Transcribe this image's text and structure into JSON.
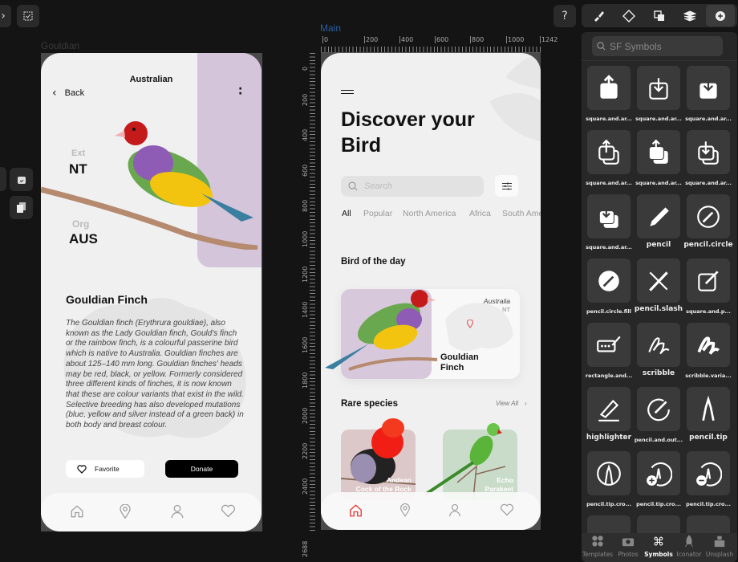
{
  "toolbar_left": {
    "expand_icon": "chevron-right-icon",
    "select_icon": "checkbox-icon"
  },
  "help_label": "?",
  "left_artboard": {
    "name": "Gouldian",
    "header_title": "Australian",
    "back_label": "Back",
    "stats": [
      {
        "label": "Ext",
        "value": "NT"
      },
      {
        "label": "Org",
        "value": "AUS"
      }
    ],
    "title": "Gouldian Finch",
    "description": "The Gouldian finch (Erythrura gouldiae), also known as the Lady Gouldian finch, Gould's finch or the rainbow finch, is a colourful passerine bird which is native to Australia. Gouldian finches are about 125–140 mm long. Gouldian finches' heads may be red, black, or yellow. Formerly considered three different kinds of finches, it is now known that these are colour variants that exist in the wild. Selective breeding has also developed mutations (blue, yellow and silver instead of a green back) in both body and breast colour.",
    "favorite_label": "Favorite",
    "donate_label": "Donate",
    "accent": "#d4c5da"
  },
  "main_artboard": {
    "name": "Main",
    "ruler_top": [
      "0",
      "200",
      "400",
      "600",
      "800",
      "1000",
      "1242"
    ],
    "ruler_left": [
      "0",
      "200",
      "400",
      "600",
      "800",
      "1000",
      "1200",
      "1400",
      "1600",
      "1800",
      "2000",
      "2200",
      "2400",
      "2688"
    ],
    "title_line1": "Discover your",
    "title_line2": "Bird",
    "search_placeholder": "Search",
    "tabs": [
      "All",
      "Popular",
      "North America",
      "Africa",
      "South Ame"
    ],
    "bird_of_day_heading": "Bird of the day",
    "bird_of_day": {
      "country": "Australia",
      "region": "NT",
      "name_line1": "Gouldian",
      "name_line2": "Finch"
    },
    "rare_heading": "Rare species",
    "view_all": "View All",
    "rare": [
      {
        "line1": "Andean",
        "line2": "Cock of the Rock",
        "bg": "#dcc8c8"
      },
      {
        "line1": "Echo",
        "line2": "Parakeet",
        "bg": "#c9dcc9"
      }
    ],
    "active_color": "#e53935"
  },
  "right_panel": {
    "tools": [
      "brush-icon",
      "component-icon",
      "boolean-icon",
      "layers-icon",
      "add-icon"
    ],
    "search_placeholder": "SF Symbols",
    "symbols": [
      "square.and.ar...",
      "square.and.ar...",
      "square.and.ar...",
      "square.and.ar...",
      "square.and.ar...",
      "square.and.ar...",
      "square.and.ar...",
      "pencil",
      "pencil.circle",
      "pencil.circle.fill",
      "pencil.slash",
      "square.and.p...",
      "rectangle.and...",
      "scribble",
      "scribble.varia...",
      "highlighter",
      "pencil.and.out...",
      "pencil.tip",
      "pencil.tip.cro...",
      "pencil.tip.cro...",
      "pencil.tip.cro...",
      "",
      "",
      ""
    ],
    "bottom_tabs": [
      "Templates",
      "Photos",
      "Symbols",
      "Iconator",
      "Unsplash"
    ],
    "active_tab": "Symbols"
  }
}
